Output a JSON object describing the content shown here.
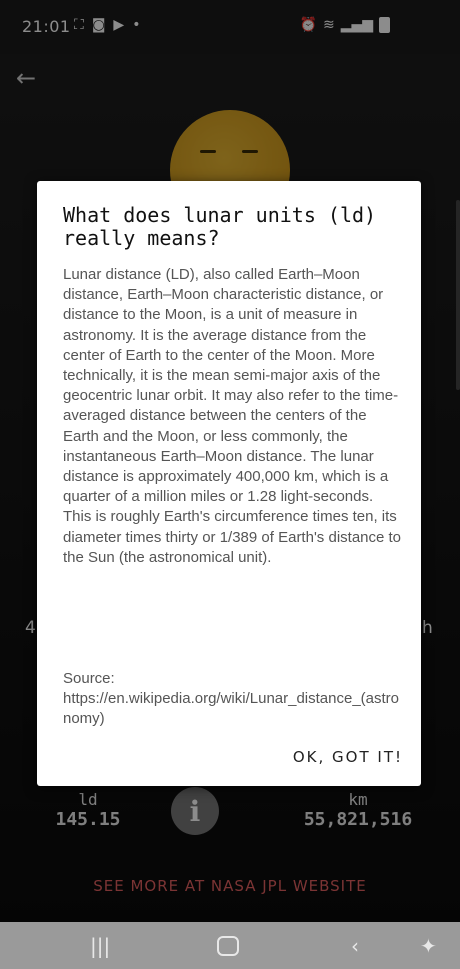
{
  "status_bar": {
    "time": "21:01"
  },
  "dialog": {
    "title": "What does lunar units (ld) really means?",
    "body": "Lunar distance (LD), also called Earth–Moon distance, Earth–Moon characteristic distance, or distance to the Moon, is a unit of measure in astronomy. It is the average distance from the center of Earth to the center of the Moon. More technically, it is the mean semi-major axis of the geocentric lunar orbit. It may also refer to the time-averaged distance between the centers of the Earth and the Moon, or less commonly, the instantaneous Earth–Moon distance. The lunar distance is approximately 400,000 km, which is a quarter of a million miles or 1.28 light-seconds. This is roughly Earth's circumference times ten, its diameter times thirty or 1/389 of Earth's distance to the Sun (the astronomical unit).",
    "source_label": "Source:",
    "source_url": "https://en.wikipedia.org/wiki/Lunar_distance_(astronomy)",
    "ok_label": "OK, GOT IT!"
  },
  "stats": {
    "ld_label": "ld",
    "ld_value": "145.15",
    "km_label": "km",
    "km_value": "55,821,516"
  },
  "background": {
    "side_left": "4",
    "side_right": "h"
  },
  "nasa_link": "SEE MORE AT NASA JPL WEBSITE",
  "icons": {
    "back": "arrow-left-icon",
    "info": "info-icon",
    "nav": [
      "recent-apps-icon",
      "home-icon",
      "back-icon",
      "accessibility-icon"
    ]
  },
  "colors": {
    "accent_link": "#e06060",
    "dialog_bg": "#ffffff",
    "emoji": "#d9a321"
  }
}
